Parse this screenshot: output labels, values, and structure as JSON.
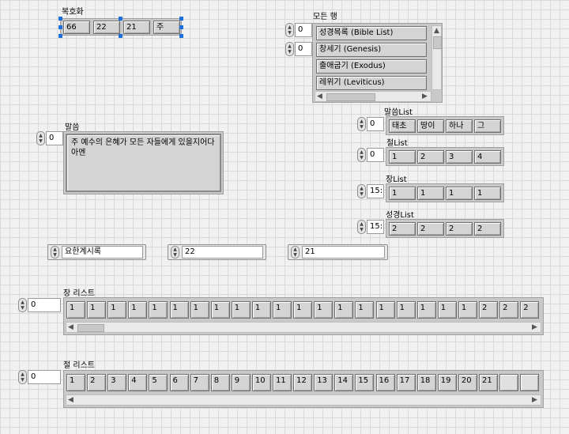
{
  "bokhohwa": {
    "label": "복호화",
    "values": [
      "66",
      "22",
      "21",
      "주"
    ]
  },
  "all_rows": {
    "label": "모든 행",
    "index_a": "0",
    "index_b": "0",
    "items": [
      "성경목록 (Bible List)",
      "창세기 (Genesis)",
      "출애굽기 (Exodus)",
      "레위기 (Leviticus)"
    ]
  },
  "malsseum": {
    "label": "말씀",
    "index": "0",
    "text": "주 예수의 은혜가 모든 자들에게 있을지어다 아멘"
  },
  "malsseum_list": {
    "label": "말씀List",
    "index": "0",
    "values": [
      "태초",
      "땅이",
      "하나",
      "그"
    ]
  },
  "jeol_list": {
    "label": "절List",
    "index": "0",
    "values": [
      "1",
      "2",
      "3",
      "4"
    ]
  },
  "jang_list": {
    "label": "장List",
    "index": "15:",
    "values": [
      "1",
      "1",
      "1",
      "1"
    ]
  },
  "seonggyeong_list": {
    "label": "성경List",
    "index": "15:",
    "values": [
      "2",
      "2",
      "2",
      "2"
    ]
  },
  "rings": [
    {
      "value": "요한계시록"
    },
    {
      "value": "22"
    },
    {
      "value": "21"
    }
  ],
  "jang_riseuteu": {
    "label": "장 리스트",
    "index": "0",
    "values": [
      "1",
      "1",
      "1",
      "1",
      "1",
      "1",
      "1",
      "1",
      "1",
      "1",
      "1",
      "1",
      "1",
      "1",
      "1",
      "1",
      "1",
      "1",
      "1",
      "1",
      "2",
      "2",
      "2"
    ]
  },
  "jeol_riseuteu": {
    "label": "절 리스트",
    "index": "0",
    "values": [
      "1",
      "2",
      "3",
      "4",
      "5",
      "6",
      "7",
      "8",
      "9",
      "10",
      "11",
      "12",
      "13",
      "14",
      "15",
      "16",
      "17",
      "18",
      "19",
      "20",
      "21",
      "",
      ""
    ]
  },
  "icons": {
    "spinner": "increment-decrement-icon",
    "left": "scroll-left-icon",
    "right": "scroll-right-icon",
    "up": "scroll-up-icon",
    "down": "scroll-down-icon"
  }
}
